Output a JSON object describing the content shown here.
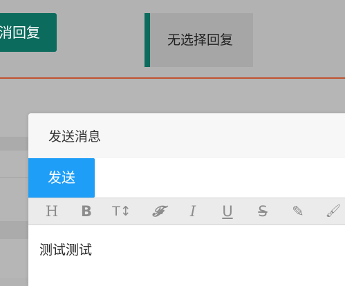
{
  "topbar": {
    "cancel_reply_label": "取消回复",
    "no_select_reply_label": "无选择回复"
  },
  "dialog": {
    "title": "发送消息",
    "send_label": "发送",
    "editor_text": "测试测试",
    "toolbar": [
      {
        "name": "heading",
        "glyph": "H"
      },
      {
        "name": "bold",
        "glyph": "B"
      },
      {
        "name": "font-size",
        "glyph": "T↕"
      },
      {
        "name": "font-family",
        "glyph": "𝓕"
      },
      {
        "name": "italic",
        "glyph": "I"
      },
      {
        "name": "underline",
        "glyph": "U"
      },
      {
        "name": "strikethrough",
        "glyph": "S"
      },
      {
        "name": "highlighter",
        "glyph": "✎"
      },
      {
        "name": "brush",
        "glyph": "🖌"
      }
    ]
  },
  "colors": {
    "accent_green": "#0b6b5d",
    "send_blue": "#1f9ef8",
    "divider_red": "#c0522f"
  }
}
